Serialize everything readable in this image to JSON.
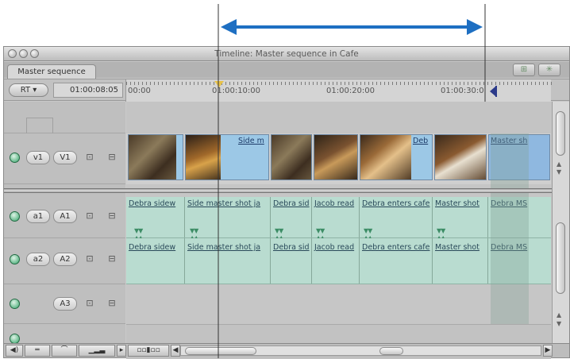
{
  "window": {
    "title": "Timeline: Master sequence in Cafe"
  },
  "tab": {
    "label": "Master sequence"
  },
  "controls": {
    "rt_label": "RT",
    "timecode": "01:00:08:05"
  },
  "ruler": {
    "labels": [
      "00:00",
      "01:00:10:00",
      "01:00:20:00",
      "01:00:30:0"
    ]
  },
  "tracks": {
    "v1": {
      "source": "v1",
      "dest": "V1"
    },
    "a1": {
      "source": "a1",
      "dest": "A1"
    },
    "a2": {
      "source": "a2",
      "dest": "A2"
    },
    "a3": {
      "dest": "A3"
    }
  },
  "video_clips": [
    {
      "label": ""
    },
    {
      "label": "Side m"
    },
    {
      "label": ""
    },
    {
      "label": ""
    },
    {
      "label": "Deb"
    },
    {
      "label": ""
    },
    {
      "label": "Master sh"
    }
  ],
  "audio_a1": [
    "Debra sidew",
    "Side master shot ja",
    "Debra sid",
    "Jacob read",
    "Debra enters cafe",
    "Master shot",
    "Debra MS"
  ],
  "audio_a2": [
    "Debra sidew",
    "Side master shot ja",
    "Debra sid",
    "Jacob read",
    "Debra enters cafe",
    "Master shot",
    "Debra MS"
  ],
  "colors": {
    "annotation_arrow": "#1e6fc2",
    "audio_track": "#b9dcd0",
    "video_clip": "#9cc8e6",
    "out_point": "#2b3a8a"
  }
}
